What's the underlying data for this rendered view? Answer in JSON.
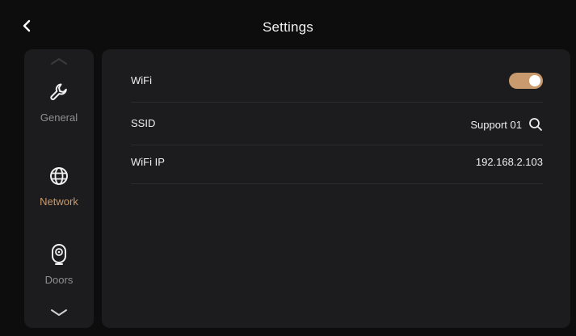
{
  "header": {
    "title": "Settings"
  },
  "sidebar": {
    "items": [
      {
        "label": "General",
        "icon": "wrench-icon",
        "active": false
      },
      {
        "label": "Network",
        "icon": "globe-icon",
        "active": true
      },
      {
        "label": "Doors",
        "icon": "door-camera-icon",
        "active": false
      }
    ]
  },
  "network": {
    "wifi": {
      "label": "WiFi",
      "enabled": true
    },
    "ssid": {
      "label": "SSID",
      "value": "Support 01"
    },
    "wifi_ip": {
      "label": "WiFi IP",
      "value": "192.168.2.103"
    }
  },
  "colors": {
    "accent": "#c99a6d",
    "panel": "#1c1c1e",
    "background": "#0d0d0d"
  }
}
